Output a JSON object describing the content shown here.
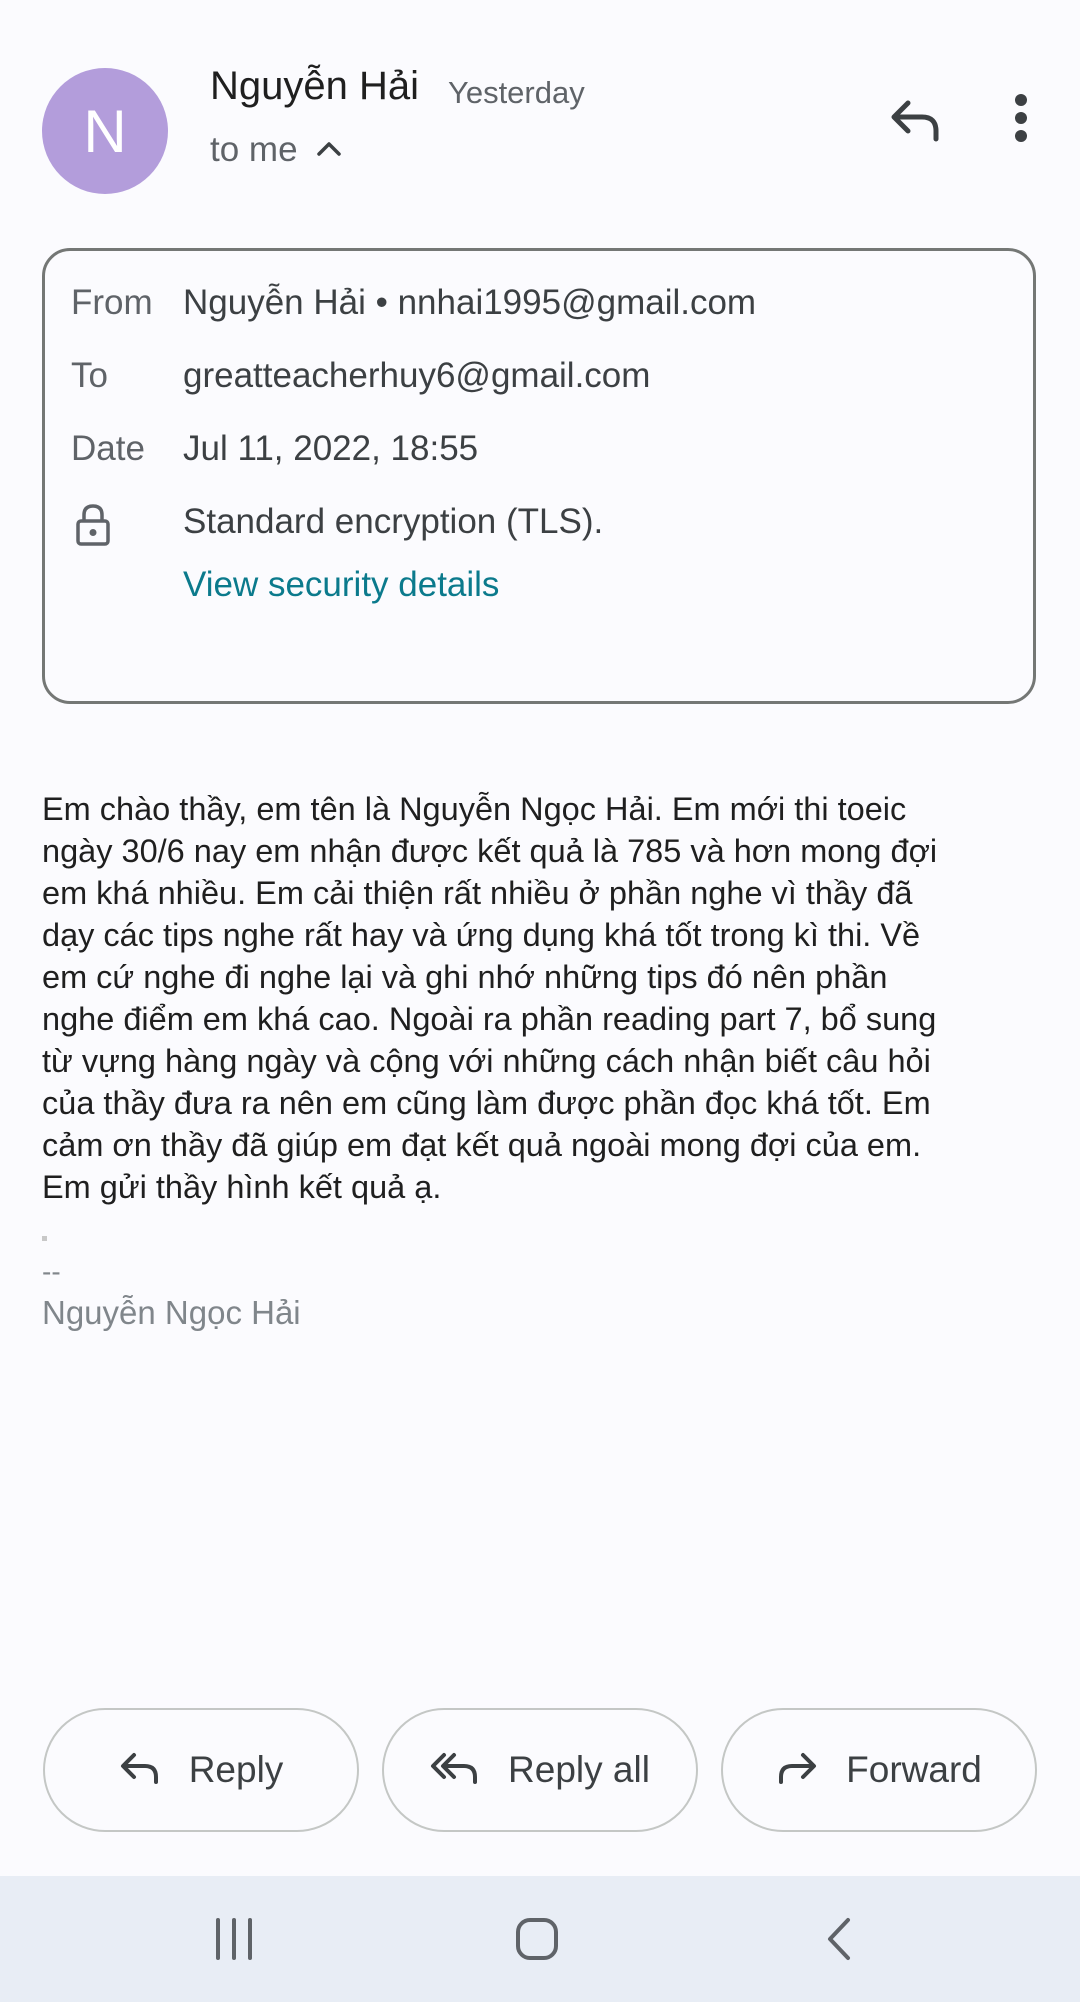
{
  "header": {
    "avatar_letter": "N",
    "avatar_color": "#b39ddb",
    "sender_name": "Nguyễn Hải",
    "time": "Yesterday",
    "recipient": "to me",
    "icons": [
      "chevron-up-icon",
      "reply-icon",
      "more-vert-icon"
    ]
  },
  "details": {
    "from_label": "From",
    "from_value": "Nguyễn Hải • nnhai1995@gmail.com",
    "to_label": "To",
    "to_value": "greatteacherhuy6@gmail.com",
    "date_label": "Date",
    "date_value": "Jul 11, 2022, 18:55",
    "encryption": "Standard encryption (TLS).",
    "security_link": "View security details",
    "link_color": "#0b7a8c"
  },
  "body": {
    "lines": [
      "Em chào thầy, em tên là Nguyễn Ngọc Hải. Em mới thi toeic",
      "ngày 30/6 nay em nhận được kết quả là 785 và hơn mong đợi",
      "em khá nhiều. Em cải thiện rất nhiều ở phần nghe vì thầy đã",
      "dạy các tips nghe rất hay và ứng dụng khá tốt trong kì thi. Về",
      "em cứ nghe đi nghe lại và ghi nhớ những tips đó nên phần",
      "nghe điểm em khá cao. Ngoài ra phần reading part 7, bổ sung",
      "từ vựng hàng ngày và cộng với những cách nhận biết câu hỏi",
      "của thầy đưa ra nên em cũng làm được phần đọc khá tốt. Em",
      "cảm ơn thầy đã giúp em đạt kết quả ngoài mong đợi của em.",
      "Em gửi thầy hình kết quả ạ."
    ]
  },
  "signature": {
    "dashes": "--",
    "name": "Nguyễn Ngọc Hải"
  },
  "actions": {
    "reply": "Reply",
    "reply_all": "Reply all",
    "forward": "Forward"
  },
  "nav": {
    "icons": [
      "recent-apps-icon",
      "home-icon",
      "back-icon"
    ]
  }
}
